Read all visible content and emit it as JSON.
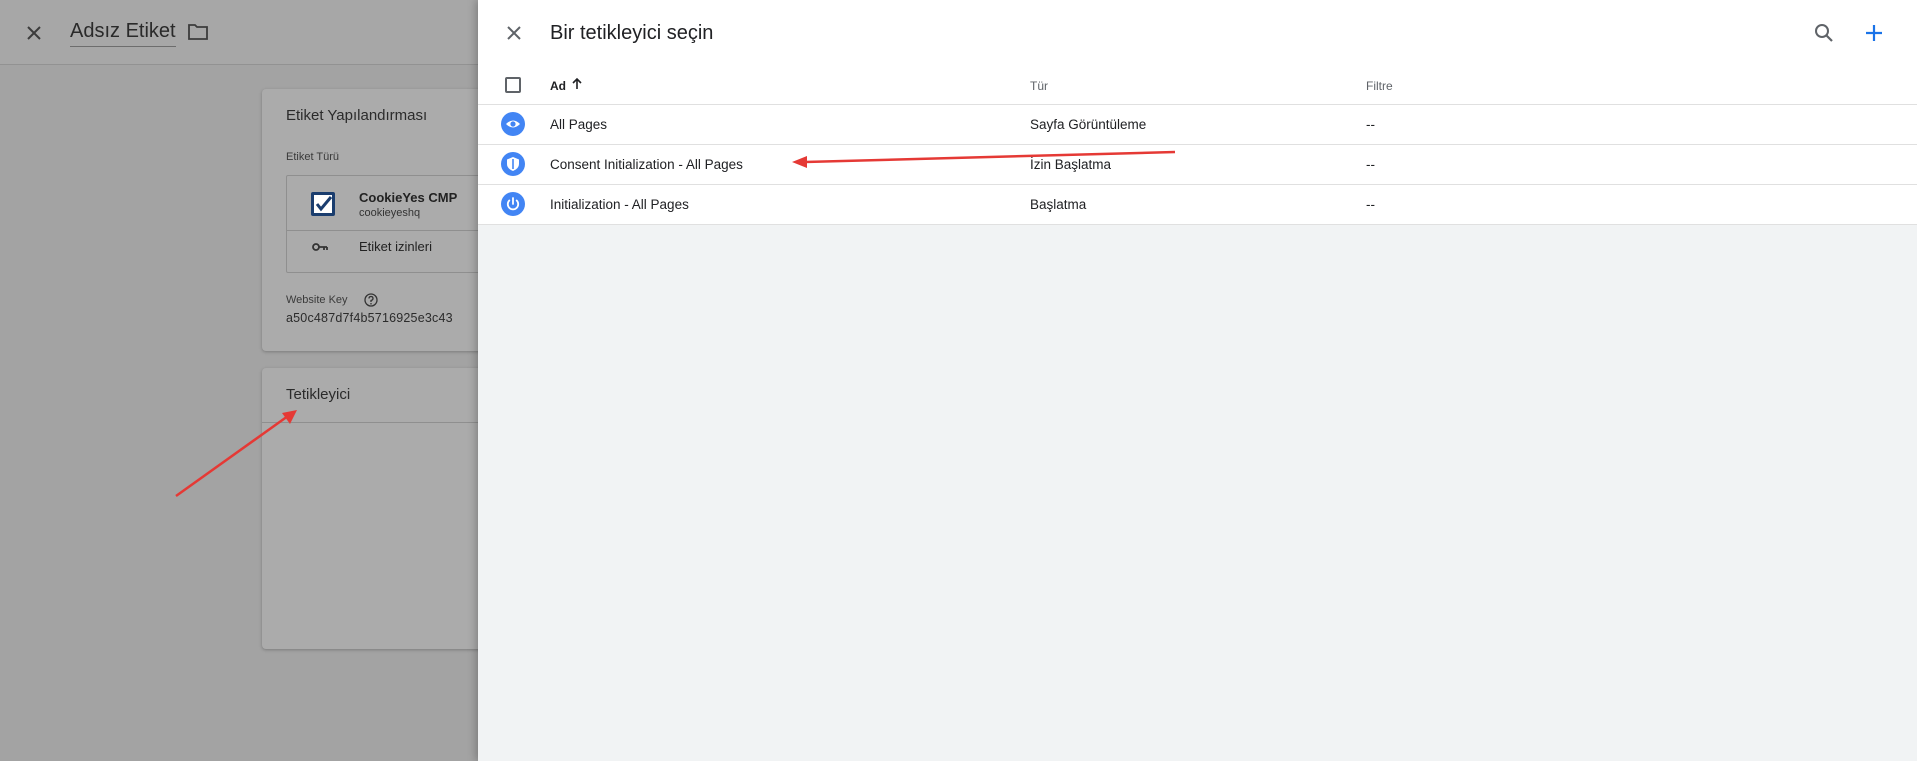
{
  "background": {
    "header": {
      "title": "Adsız Etiket"
    },
    "config_card": {
      "title": "Etiket Yapılandırması",
      "tag_type_label": "Etiket Türü",
      "tag_name": "CookieYes CMP",
      "tag_vendor": "cookieyeshq",
      "permissions_label": "Etiket izinleri",
      "website_key_label": "Website Key",
      "website_key_value": "a50c487d7f4b5716925e3c43"
    },
    "trigger_card": {
      "title": "Tetikleyici"
    }
  },
  "panel": {
    "title": "Bir tetikleyici seçin",
    "columns": {
      "name": "Ad",
      "type": "Tür",
      "filter": "Filtre"
    },
    "rows": [
      {
        "name": "All Pages",
        "type": "Sayfa Görüntüleme",
        "filter": "--",
        "icon": "eye-icon"
      },
      {
        "name": "Consent Initialization - All Pages",
        "type": "İzin Başlatma",
        "filter": "--",
        "icon": "shield-icon"
      },
      {
        "name": "Initialization - All Pages",
        "type": "Başlatma",
        "filter": "--",
        "icon": "power-icon"
      }
    ]
  },
  "colors": {
    "accent": "#1a73e8",
    "row_icon": "#4285f4",
    "annotation_arrow": "#e53935"
  }
}
